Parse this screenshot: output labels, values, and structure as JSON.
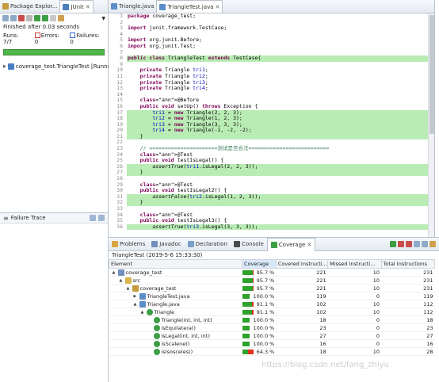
{
  "left_panel": {
    "tabs": [
      {
        "label": "Package Explor..."
      },
      {
        "label": "JUnit"
      }
    ],
    "status": "Finished after 0.03 seconds",
    "runs_label": "Runs:",
    "runs_value": "7/7",
    "errors_label": "Errors:",
    "errors_value": "0",
    "failures_label": "Failures:",
    "failures_value": "0",
    "progress_color": "#4fb649",
    "test_item": "coverage_test.TriangleTest [Runner: JU",
    "failure_trace_label": "Failure Trace"
  },
  "editor": {
    "tabs": [
      {
        "label": "Triangle.java"
      },
      {
        "label": "TriangleTest.java"
      }
    ],
    "lines": [
      {
        "n": "1",
        "t": "package coverage_test;",
        "h": false
      },
      {
        "n": "2",
        "t": "",
        "h": false
      },
      {
        "n": "3",
        "t": "import junit.framework.TestCase;",
        "h": false
      },
      {
        "n": "4",
        "t": "",
        "h": false
      },
      {
        "n": "5",
        "t": "import org.junit.Before;",
        "h": false
      },
      {
        "n": "6",
        "t": "import org.junit.Test;",
        "h": false
      },
      {
        "n": "7",
        "t": "",
        "h": false
      },
      {
        "n": "8",
        "t": "public class TriangleTest extends TestCase{",
        "h": true
      },
      {
        "n": "9",
        "t": "",
        "h": false
      },
      {
        "n": "10",
        "t": "    private Triangle tri1;",
        "h": false
      },
      {
        "n": "11",
        "t": "    private Triangle tri2;",
        "h": false
      },
      {
        "n": "12",
        "t": "    private Triangle tri3;",
        "h": false
      },
      {
        "n": "13",
        "t": "    private Triangle tri4;",
        "h": false
      },
      {
        "n": "14",
        "t": "",
        "h": false
      },
      {
        "n": "15",
        "t": "    @Before",
        "h": false
      },
      {
        "n": "16",
        "t": "    public void setUp() throws Exception {",
        "h": false
      },
      {
        "n": "17",
        "t": "        tri1 = new Triangle(2, 2, 3);",
        "h": true
      },
      {
        "n": "18",
        "t": "        tri2 = new Triangle(1, 2, 3);",
        "h": true
      },
      {
        "n": "19",
        "t": "        tri3 = new Triangle(3, 3, 3);",
        "h": true
      },
      {
        "n": "20",
        "t": "        tri4 = new Triangle(-1, -2, -2);",
        "h": true
      },
      {
        "n": "21",
        "t": "    }",
        "h": true
      },
      {
        "n": "22",
        "t": "",
        "h": false
      },
      {
        "n": "23",
        "t": "    // ======================测试是否合法==========================",
        "h": false
      },
      {
        "n": "24",
        "t": "    @Test",
        "h": false
      },
      {
        "n": "25",
        "t": "    public void testIsLegal() {",
        "h": false
      },
      {
        "n": "26",
        "t": "        assertTrue(tri1.isLegal(2, 2, 3));",
        "h": true
      },
      {
        "n": "27",
        "t": "    }",
        "h": true
      },
      {
        "n": "28",
        "t": "",
        "h": false
      },
      {
        "n": "29",
        "t": "    @Test",
        "h": false
      },
      {
        "n": "30",
        "t": "    public void testIsLegal2() {",
        "h": false
      },
      {
        "n": "31",
        "t": "        assertFalse(tri2.isLegal(1, 2, 3));",
        "h": true
      },
      {
        "n": "32",
        "t": "    }",
        "h": true
      },
      {
        "n": "33",
        "t": "",
        "h": false
      },
      {
        "n": "34",
        "t": "    @Test",
        "h": false
      },
      {
        "n": "35",
        "t": "    public void testIsLegal3() {",
        "h": false
      },
      {
        "n": "36",
        "t": "        assertTrue(tri3.isLegal(3, 3, 3));",
        "h": true
      }
    ]
  },
  "bottom": {
    "tabs": [
      {
        "label": "Problems"
      },
      {
        "label": "Javadoc"
      },
      {
        "label": "Declaration"
      },
      {
        "label": "Console"
      },
      {
        "label": "Coverage"
      }
    ],
    "session": "TriangleTest (2019-5-6 15:33:30)",
    "columns": [
      "Element",
      "Coverage",
      "Covered Instructi...",
      "Missed Instructi...",
      "Total Instructions"
    ],
    "rows": [
      {
        "indent": 0,
        "twisty": "▲",
        "icon": "project",
        "name": "coverage_test",
        "cov": "95.7 %",
        "frac": 0.957,
        "covered": "221",
        "missed": "10",
        "total": "231"
      },
      {
        "indent": 1,
        "twisty": "▲",
        "icon": "folder",
        "name": "src",
        "cov": "95.7 %",
        "frac": 0.957,
        "covered": "221",
        "missed": "10",
        "total": "231"
      },
      {
        "indent": 2,
        "twisty": "▲",
        "icon": "package",
        "name": "coverage_test",
        "cov": "95.7 %",
        "frac": 0.957,
        "covered": "221",
        "missed": "10",
        "total": "231"
      },
      {
        "indent": 3,
        "twisty": "▶",
        "icon": "java",
        "name": "TriangleTest.java",
        "cov": "100.0 %",
        "frac": 1.0,
        "covered": "119",
        "missed": "0",
        "total": "119"
      },
      {
        "indent": 3,
        "twisty": "▲",
        "icon": "java",
        "name": "Triangle.java",
        "cov": "91.1 %",
        "frac": 0.911,
        "covered": "102",
        "missed": "10",
        "total": "112"
      },
      {
        "indent": 4,
        "twisty": "▲",
        "icon": "class",
        "name": "Triangle",
        "cov": "91.1 %",
        "frac": 0.911,
        "covered": "102",
        "missed": "10",
        "total": "112"
      },
      {
        "indent": 5,
        "twisty": "",
        "icon": "method",
        "name": "Triangle(int, int, int)",
        "cov": "100.0 %",
        "frac": 1.0,
        "covered": "18",
        "missed": "0",
        "total": "18"
      },
      {
        "indent": 5,
        "twisty": "",
        "icon": "method",
        "name": "isEquilatera()",
        "cov": "100.0 %",
        "frac": 1.0,
        "covered": "23",
        "missed": "0",
        "total": "23"
      },
      {
        "indent": 5,
        "twisty": "",
        "icon": "method",
        "name": "isLegal(int, int, int)",
        "cov": "100.0 %",
        "frac": 1.0,
        "covered": "27",
        "missed": "0",
        "total": "27"
      },
      {
        "indent": 5,
        "twisty": "",
        "icon": "method",
        "name": "isScalene()",
        "cov": "100.0 %",
        "frac": 1.0,
        "covered": "16",
        "missed": "0",
        "total": "16"
      },
      {
        "indent": 5,
        "twisty": "",
        "icon": "method",
        "name": "isIsosceles()",
        "cov": "64.3 %",
        "frac": 0.643,
        "covered": "18",
        "missed": "10",
        "total": "28"
      }
    ]
  },
  "colors": {
    "covered": "#2ea22a",
    "missed": "#e0301e",
    "highlight": "#b9ecb4"
  },
  "watermark": "https://blog.csdn.net/fang_zhiyu"
}
